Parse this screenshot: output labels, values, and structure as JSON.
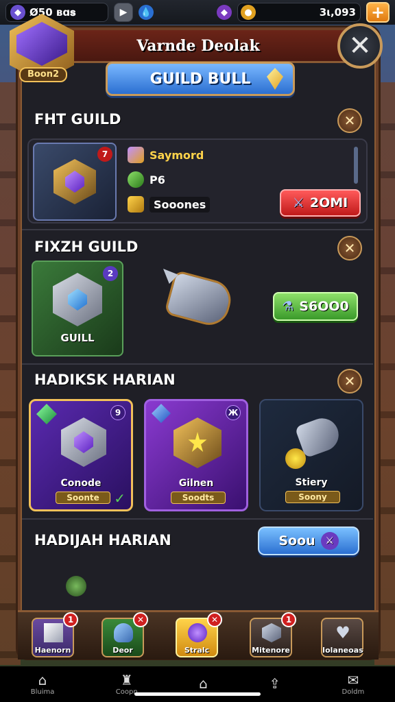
{
  "status_bar": {
    "left_value": "Ø50 ʙɑ𝐬",
    "right_value": "3ι,093",
    "plus_label": "+"
  },
  "avatar": {
    "label": "Boon2"
  },
  "panel": {
    "title": "Varnde Deolak",
    "guild_button": "GUILD BULL",
    "close": "✕"
  },
  "section1": {
    "title": "FHT GUILD",
    "badge": "7",
    "stats": [
      {
        "icon": "cube-icon",
        "text": "Saymord",
        "color": "#ffd34a"
      },
      {
        "icon": "leaf-icon",
        "text": "P6",
        "color": "#ffffff"
      },
      {
        "icon": "gold-icon",
        "text": "Sooones",
        "color": "#ffffff"
      }
    ],
    "button": "2OMI"
  },
  "section2": {
    "title": "FIXZH GUILD",
    "badge": "2",
    "tile_label": "GUILL",
    "button": "S6OO0"
  },
  "section3": {
    "title": "HADIKSK HARIAN",
    "cards": [
      {
        "name": "Conode",
        "tag": "Soonte",
        "badge": "9",
        "check": "✓"
      },
      {
        "name": "Gilnen",
        "tag": "Soodts",
        "badge": "Ж"
      },
      {
        "name": "Stiery",
        "tag": "Soony"
      }
    ]
  },
  "section4": {
    "title": "HADIJAH HARIAN",
    "button": "Soou"
  },
  "tabs": [
    {
      "label": "Haenorn",
      "badge": "1"
    },
    {
      "label": "Deor",
      "badge": "✕"
    },
    {
      "label": "Stralc",
      "badge": "✕"
    },
    {
      "label": "Mitenore",
      "badge": "1"
    },
    {
      "label": "Iolaneoas"
    }
  ],
  "sysnav": [
    {
      "label": "Bluima",
      "icon": "⌂"
    },
    {
      "label": "Coopn",
      "icon": "♜"
    },
    {
      "label": "",
      "icon": "⌂"
    },
    {
      "label": "",
      "icon": "⇪"
    },
    {
      "label": "Doldm",
      "icon": "✉"
    }
  ]
}
